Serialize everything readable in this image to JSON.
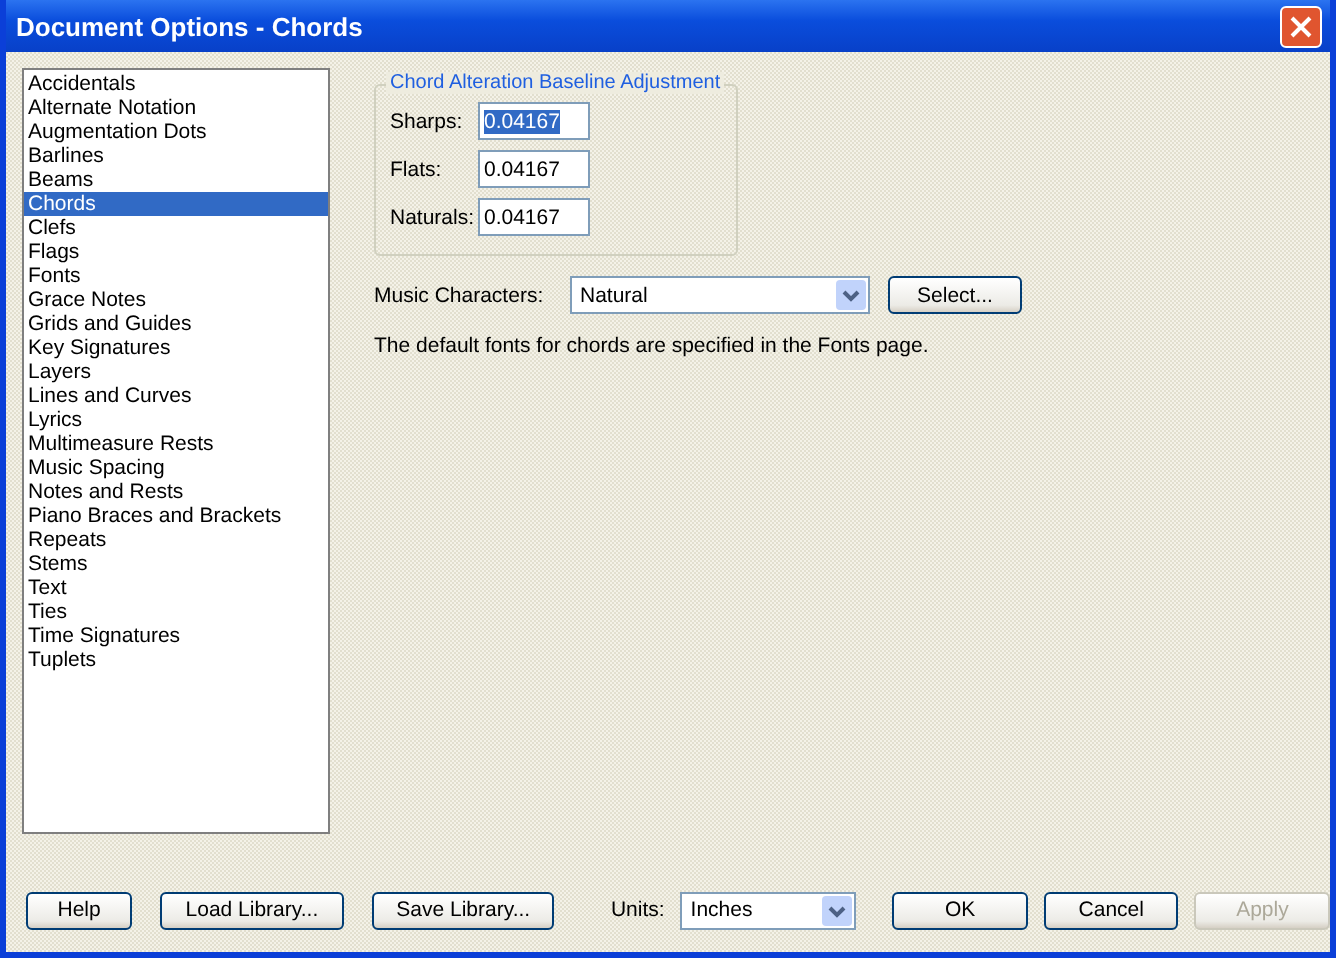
{
  "window": {
    "title": "Document Options - Chords"
  },
  "categories": [
    {
      "label": "Accidentals",
      "selected": false
    },
    {
      "label": "Alternate Notation",
      "selected": false
    },
    {
      "label": "Augmentation Dots",
      "selected": false
    },
    {
      "label": "Barlines",
      "selected": false
    },
    {
      "label": "Beams",
      "selected": false
    },
    {
      "label": "Chords",
      "selected": true
    },
    {
      "label": "Clefs",
      "selected": false
    },
    {
      "label": "Flags",
      "selected": false
    },
    {
      "label": "Fonts",
      "selected": false
    },
    {
      "label": "Grace Notes",
      "selected": false
    },
    {
      "label": "Grids and Guides",
      "selected": false
    },
    {
      "label": "Key Signatures",
      "selected": false
    },
    {
      "label": "Layers",
      "selected": false
    },
    {
      "label": "Lines and Curves",
      "selected": false
    },
    {
      "label": "Lyrics",
      "selected": false
    },
    {
      "label": "Multimeasure Rests",
      "selected": false
    },
    {
      "label": "Music Spacing",
      "selected": false
    },
    {
      "label": "Notes and Rests",
      "selected": false
    },
    {
      "label": "Piano Braces and Brackets",
      "selected": false
    },
    {
      "label": "Repeats",
      "selected": false
    },
    {
      "label": "Stems",
      "selected": false
    },
    {
      "label": "Text",
      "selected": false
    },
    {
      "label": "Ties",
      "selected": false
    },
    {
      "label": "Time Signatures",
      "selected": false
    },
    {
      "label": "Tuplets",
      "selected": false
    }
  ],
  "baseline_group": {
    "title": "Chord Alteration Baseline Adjustment",
    "fields": [
      {
        "label": "Sharps:",
        "value": "0.04167",
        "selected": true
      },
      {
        "label": "Flats:",
        "value": "0.04167",
        "selected": false
      },
      {
        "label": "Naturals:",
        "value": "0.04167",
        "selected": false
      }
    ]
  },
  "music_characters": {
    "label": "Music Characters:",
    "value": "Natural",
    "button": "Select..."
  },
  "note": "The default fonts for chords are specified in the Fonts page.",
  "footer": {
    "buttons": [
      {
        "label": "Help",
        "disabled": false
      },
      {
        "label": "Load Library...",
        "disabled": false
      },
      {
        "label": "Save Library...",
        "disabled": false
      }
    ],
    "units_label": "Units:",
    "units_value": "Inches",
    "actions": [
      {
        "label": "OK",
        "disabled": false
      },
      {
        "label": "Cancel",
        "disabled": false
      },
      {
        "label": "Apply",
        "disabled": true
      }
    ]
  }
}
